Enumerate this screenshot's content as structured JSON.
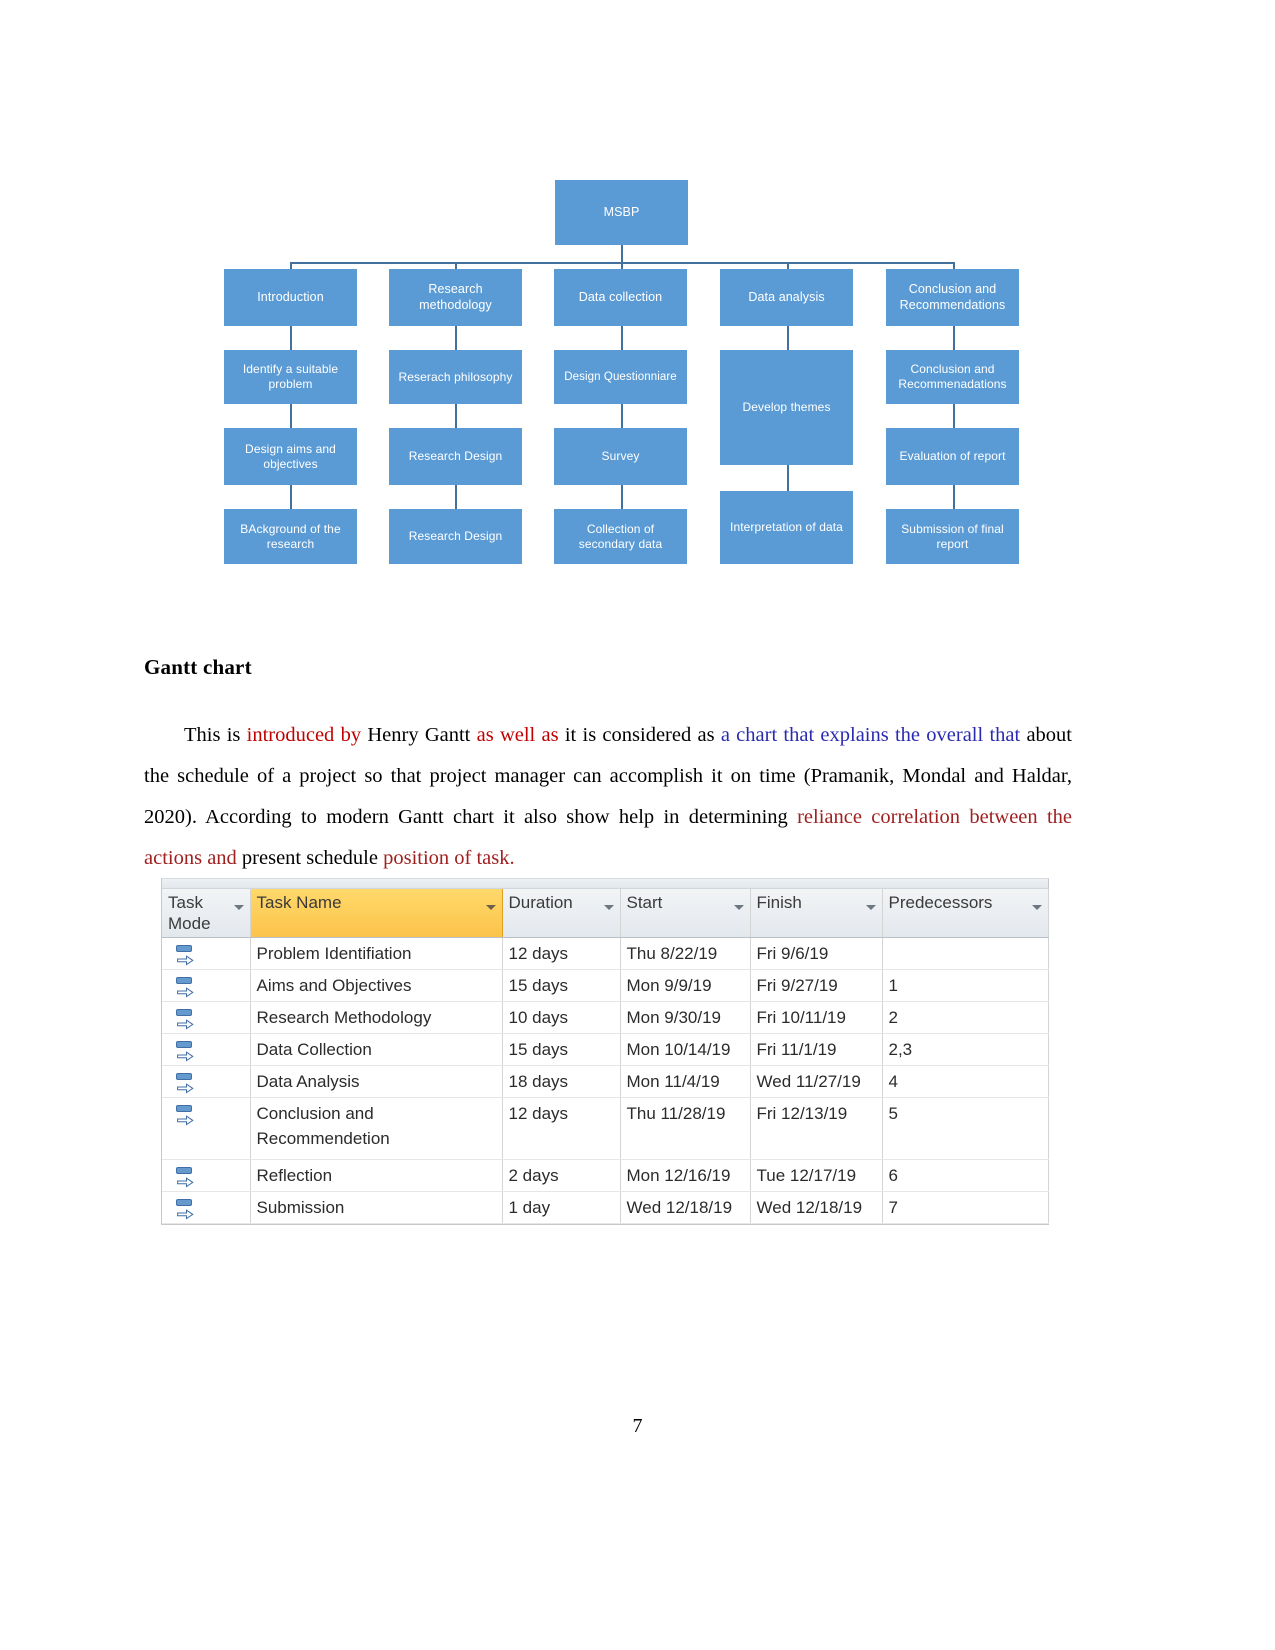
{
  "diagram": {
    "root": {
      "label": "MSBP"
    },
    "columns": [
      {
        "header": "Introduction",
        "nodes": [
          "Identify a suitable problem",
          "Design aims and objectives",
          "BAckground of the research"
        ]
      },
      {
        "header": "Research methodology",
        "nodes": [
          "Reserach philosophy",
          "Research Design",
          "Research Design"
        ]
      },
      {
        "header": "Data collection",
        "nodes": [
          "Design Questionniare",
          "Survey",
          "Collection of secondary data"
        ]
      },
      {
        "header": "Data analysis",
        "nodes": [
          "Develop themes",
          "Interpretation of data"
        ]
      },
      {
        "header": "Conclusion and Recommendations",
        "nodes": [
          "Conclusion and Recommenadations",
          "Evaluation of report",
          "Submission of final report"
        ]
      }
    ],
    "node_color": "#5B9BD5",
    "connector_color": "#41719C"
  },
  "section": {
    "heading": "Gantt chart",
    "paragraph": {
      "s1": "This is ",
      "s2": "introduced by",
      "s3": " Henry Gantt ",
      "s4": "as well as",
      "s5": " it is considered as ",
      "s6": "a chart that explains the overall that",
      "s7": " about the schedule of a project so that project manager can accomplish it on time (Pramanik, Mondal and Haldar, 2020). According to modern Gantt chart it also show help in determining ",
      "s8": "reliance correlation between the actions and",
      "s9": " present schedule ",
      "s10": "position of task."
    },
    "colors": {
      "red": "#C00000",
      "blue": "#2A2AB0",
      "dark_red": "#A02020"
    }
  },
  "gantt_table": {
    "headers": [
      "Task Mode",
      "Task Name",
      "Duration",
      "Start",
      "Finish",
      "Predecessors"
    ],
    "highlight_column": "Task Name",
    "highlight_color": "#FBC34A",
    "rows": [
      {
        "mode_icon": "manually-scheduled-icon",
        "name": "Problem Identifiation",
        "duration": "12 days",
        "start": "Thu 8/22/19",
        "finish": "Fri 9/6/19",
        "predecessors": ""
      },
      {
        "mode_icon": "manually-scheduled-icon",
        "name": "Aims and Objectives",
        "duration": "15 days",
        "start": "Mon 9/9/19",
        "finish": "Fri 9/27/19",
        "predecessors": "1"
      },
      {
        "mode_icon": "manually-scheduled-icon",
        "name": "Research Methodology",
        "duration": "10 days",
        "start": "Mon 9/30/19",
        "finish": "Fri 10/11/19",
        "predecessors": "2"
      },
      {
        "mode_icon": "manually-scheduled-icon",
        "name": "Data Collection",
        "duration": "15 days",
        "start": "Mon 10/14/19",
        "finish": "Fri 11/1/19",
        "predecessors": "2,3"
      },
      {
        "mode_icon": "manually-scheduled-icon",
        "name": "Data Analysis",
        "duration": "18 days",
        "start": "Mon 11/4/19",
        "finish": "Wed 11/27/19",
        "predecessors": "4"
      },
      {
        "mode_icon": "manually-scheduled-icon",
        "name": "Conclusion and Recommendetion",
        "duration": "12 days",
        "start": "Thu 11/28/19",
        "finish": "Fri 12/13/19",
        "predecessors": "5"
      },
      {
        "mode_icon": "manually-scheduled-icon",
        "name": "Reflection",
        "duration": "2 days",
        "start": "Mon 12/16/19",
        "finish": "Tue 12/17/19",
        "predecessors": "6"
      },
      {
        "mode_icon": "manually-scheduled-icon",
        "name": "Submission",
        "duration": "1 day",
        "start": "Wed 12/18/19",
        "finish": "Wed 12/18/19",
        "predecessors": "7"
      }
    ]
  },
  "footer": {
    "page_number": "7"
  }
}
